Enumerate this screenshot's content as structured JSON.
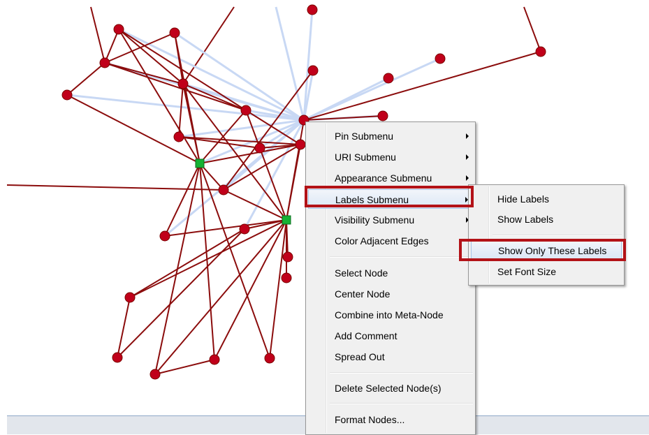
{
  "context_menu": {
    "items": [
      {
        "label": "Pin Submenu",
        "submenu": true
      },
      {
        "label": "URI Submenu",
        "submenu": true
      },
      {
        "label": "Appearance Submenu",
        "submenu": true
      },
      {
        "label": "Labels Submenu",
        "submenu": true
      },
      {
        "label": "Visibility Submenu",
        "submenu": true
      },
      {
        "label": "Color Adjacent Edges",
        "submenu": false
      },
      {
        "label": "Select Node",
        "submenu": false
      },
      {
        "label": "Center Node",
        "submenu": false
      },
      {
        "label": "Combine into Meta-Node",
        "submenu": false
      },
      {
        "label": "Add Comment",
        "submenu": false
      },
      {
        "label": "Spread Out",
        "submenu": false
      },
      {
        "label": "Delete Selected Node(s)",
        "submenu": false
      },
      {
        "label": "Format Nodes...",
        "submenu": false
      }
    ]
  },
  "labels_submenu": {
    "items": [
      {
        "label": "Hide Labels"
      },
      {
        "label": "Show Labels"
      },
      {
        "label": "Show Only These Labels"
      },
      {
        "label": "Set Font Size"
      }
    ]
  },
  "colors": {
    "node_fill": "#c0001a",
    "edge": "#8b0c0c",
    "highlight_edge": "#c8d8f4",
    "meta_node": "#16b234",
    "callout": "#b31217"
  }
}
